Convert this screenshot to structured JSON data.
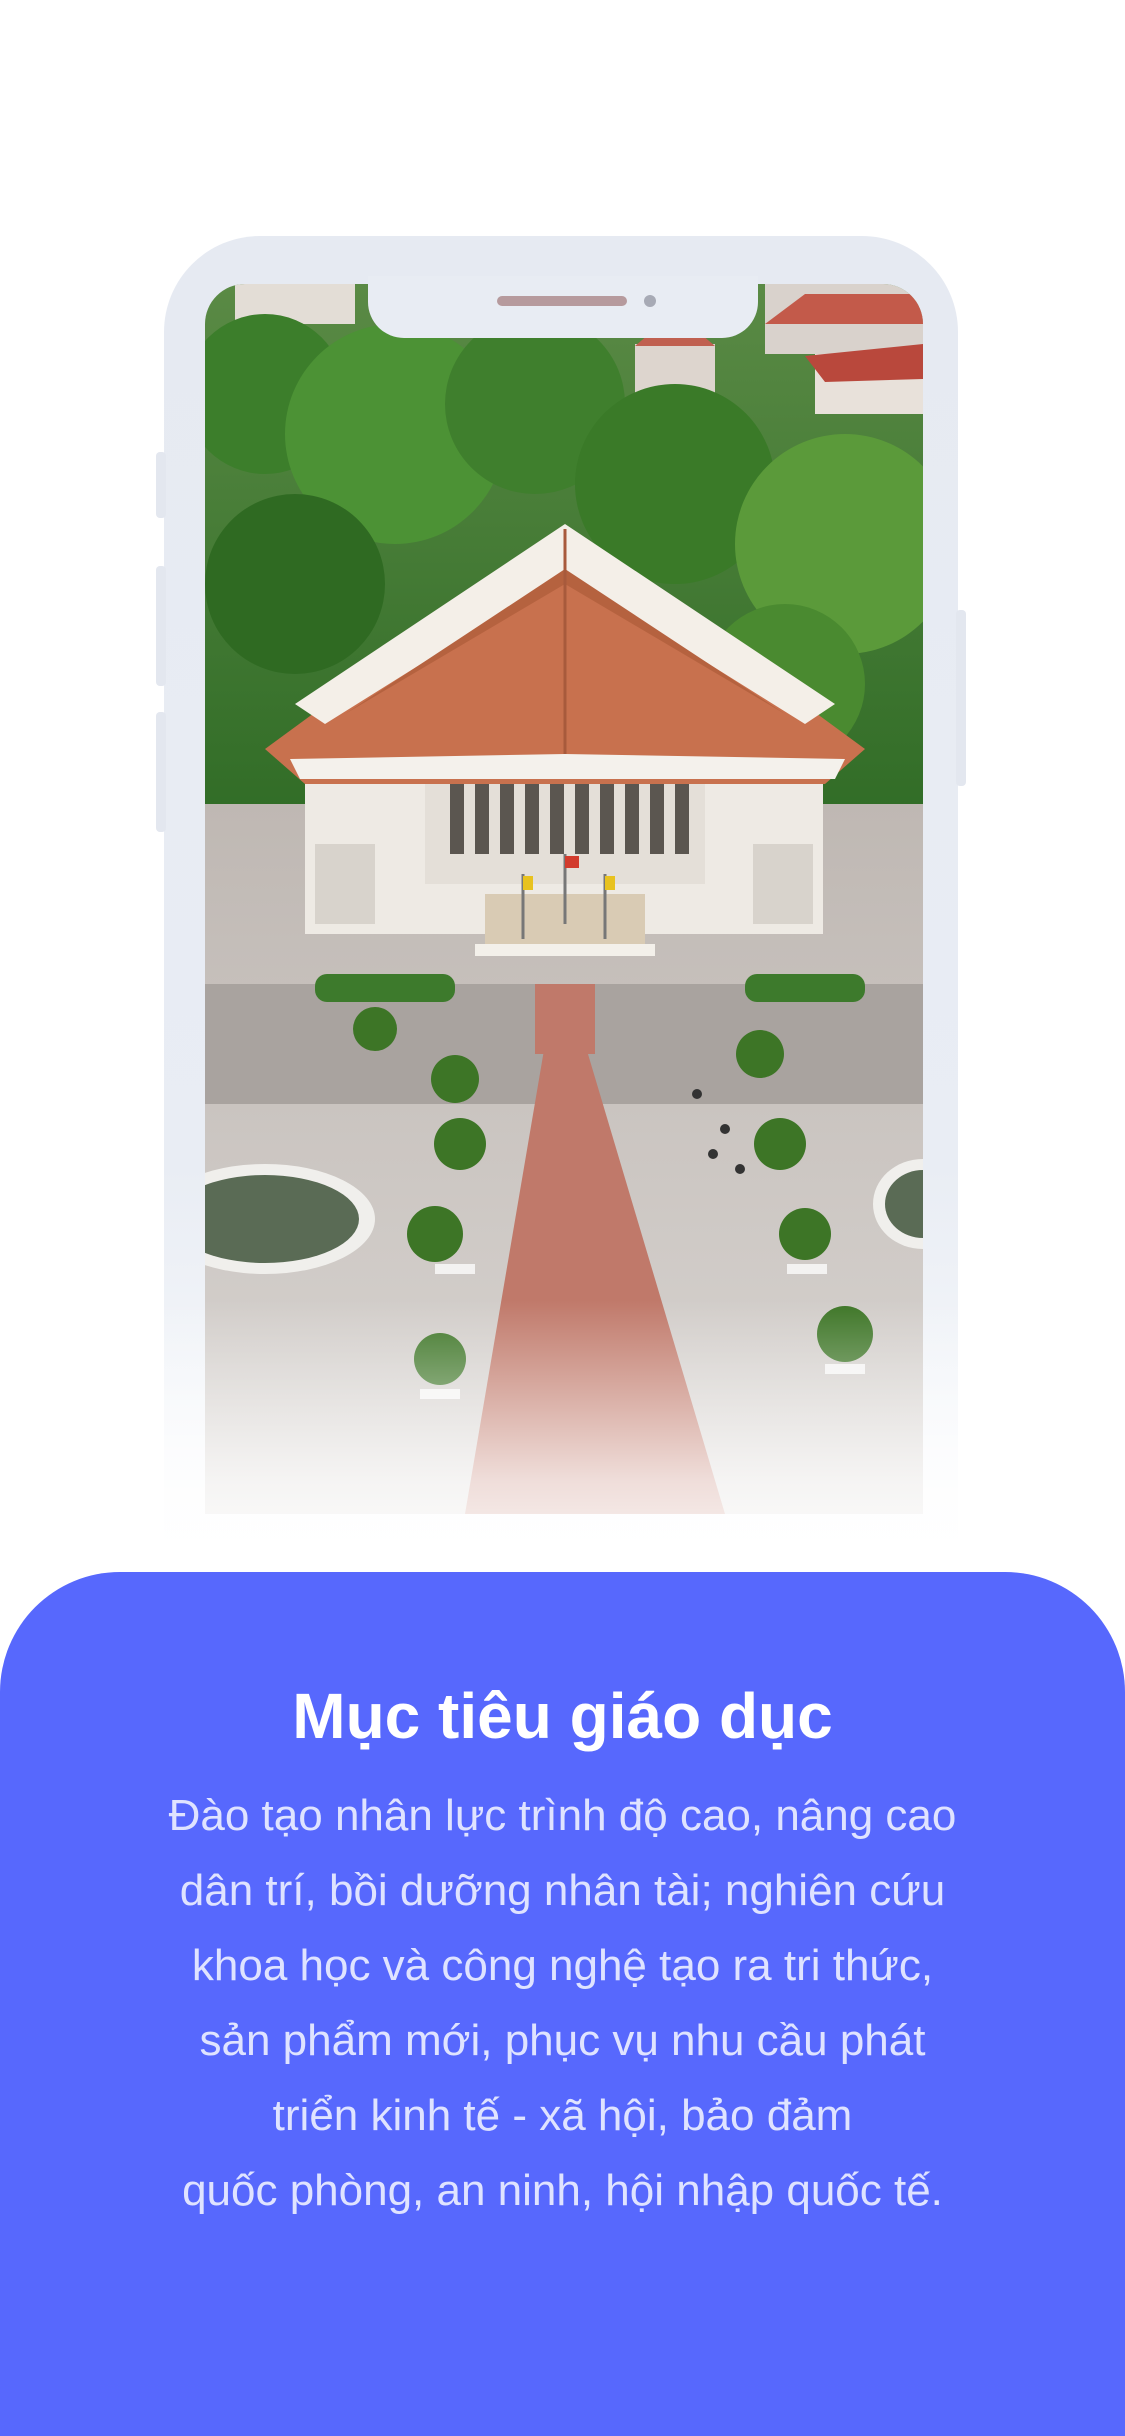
{
  "hero": {
    "photo": "aerial-university-hall-photo",
    "colors": {
      "phone_frame": "#e6eaf2",
      "roof": "#c8714e",
      "trees": "#3f8a2e",
      "plaza": "#c9c4c0"
    }
  },
  "card": {
    "title": "Mục tiêu giáo dục",
    "lines": [
      "Đào tạo nhân lực trình độ cao, nâng cao",
      "dân trí, bồi dưỡng nhân tài; nghiên cứu",
      "khoa học và công nghệ tạo ra tri thức,",
      "sản phẩm mới, phục vụ nhu cầu phát",
      "triển kinh tế - xã hội, bảo đảm",
      "quốc phòng, an ninh, hội nhập quốc tế."
    ],
    "background_color": "#5768fd",
    "text_color": "#dfe3ff"
  }
}
